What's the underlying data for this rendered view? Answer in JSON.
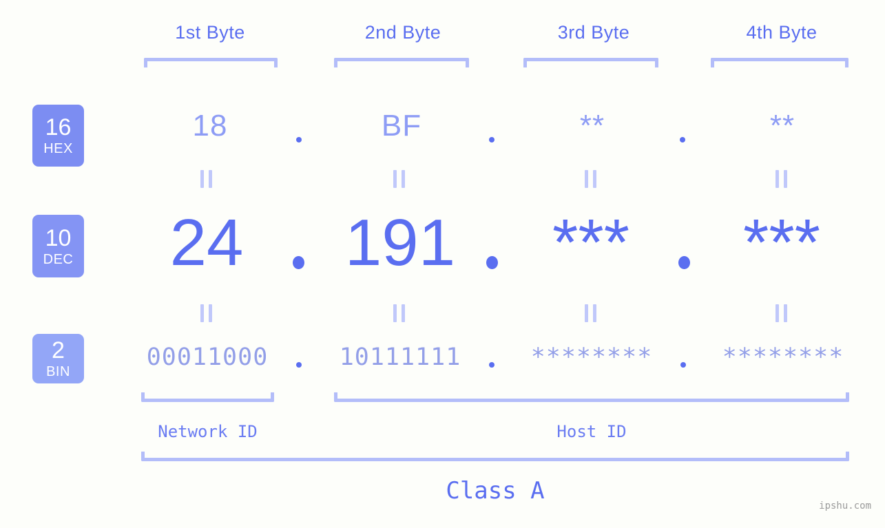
{
  "meta": {
    "background_color": "#fdfefa",
    "accent_color": "#5a6ef0",
    "light_accent_color": "#b3bdf9",
    "watermark": "ipshu.com"
  },
  "byte_headers": [
    {
      "label": "1st Byte"
    },
    {
      "label": "2nd Byte"
    },
    {
      "label": "3rd Byte"
    },
    {
      "label": "4th Byte"
    }
  ],
  "rows": [
    {
      "badge": {
        "number": "16",
        "name": "HEX",
        "color": "#7c8df2"
      },
      "values": [
        "18",
        "BF",
        "**",
        "**"
      ],
      "separator": "."
    },
    {
      "badge": {
        "number": "10",
        "name": "DEC",
        "color": "#8494f4"
      },
      "values": [
        "24",
        "191",
        "***",
        "***"
      ],
      "separator": "."
    },
    {
      "badge": {
        "number": "2",
        "name": "BIN",
        "color": "#93a6f7"
      },
      "values": [
        "00011000",
        "10111111",
        "********",
        "********"
      ],
      "separator": "."
    }
  ],
  "equal_marks": {
    "glyph": "||"
  },
  "sections": [
    {
      "label": "Network ID"
    },
    {
      "label": "Host ID"
    }
  ],
  "class": {
    "label": "Class A"
  }
}
